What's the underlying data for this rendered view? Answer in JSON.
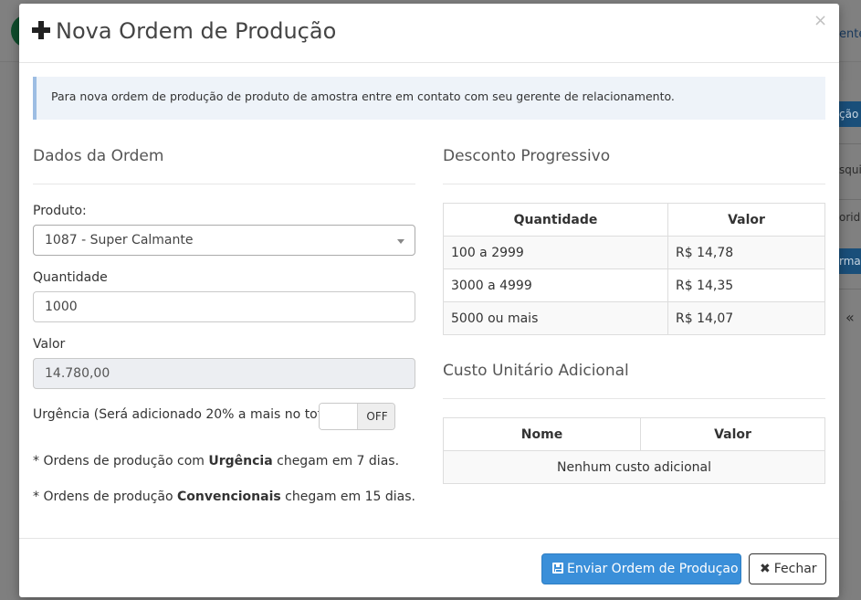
{
  "background": {
    "top_link": "ente",
    "tabs": [
      "ção",
      "squi",
      "orida",
      "rmal"
    ],
    "chevron": "«"
  },
  "modal": {
    "title": "Nova Ordem de Produção",
    "close_glyph": "×",
    "alert_text": "Para nova ordem de produção de produto de amostra entre em contato com seu gerente de relacionamento.",
    "order_section": {
      "title": "Dados da Ordem",
      "product_label": "Produto:",
      "product_value": "1087 - Super Calmante",
      "quantity_label": "Quantidade",
      "quantity_value": "1000",
      "value_label": "Valor",
      "value_value": "14.780,00",
      "urgency_label": "Urgência (Será adicionado 20% a mais no total):",
      "urgency_toggle": "OFF",
      "note1": {
        "prefix": "* Ordens de produção com ",
        "bold": "Urgência",
        "suffix": " chegam em 7 dias."
      },
      "note2": {
        "prefix": "* Ordens de produção ",
        "bold": "Convencionais",
        "suffix": " chegam em 15 dias."
      }
    },
    "discount_section": {
      "title": "Desconto Progressivo",
      "headers": [
        "Quantidade",
        "Valor"
      ],
      "rows": [
        {
          "quantity": "100 a 2999",
          "value": "R$ 14,78"
        },
        {
          "quantity": "3000 a 4999",
          "value": "R$ 14,35"
        },
        {
          "quantity": "5000 ou mais",
          "value": "R$ 14,07"
        }
      ]
    },
    "extra_cost_section": {
      "title": "Custo Unitário Adicional",
      "headers": [
        "Nome",
        "Valor"
      ],
      "empty_text": "Nenhum custo adicional"
    },
    "footer": {
      "submit_label": "Enviar Ordem de Produçao",
      "close_label": "Fechar"
    },
    "colors": {
      "primary": "#3a8fd9",
      "alert_bg": "#eef3f9",
      "alert_border": "#9dbde3"
    }
  }
}
